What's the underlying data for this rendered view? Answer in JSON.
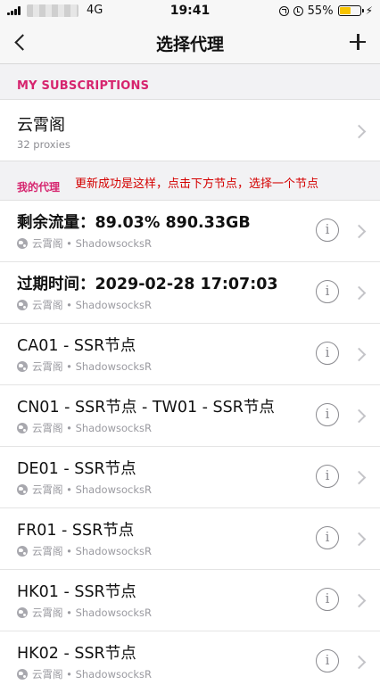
{
  "status_bar": {
    "network": "4G",
    "time": "19:41",
    "battery_percent": "55%",
    "battery_level": 0.55
  },
  "nav": {
    "title": "选择代理",
    "back_icon": "chevron-left-icon",
    "add_icon": "plus-icon"
  },
  "subscriptions": {
    "header": "MY SUBSCRIPTIONS",
    "item": {
      "name": "云霄阁",
      "count": "32 proxies"
    }
  },
  "my_proxies": {
    "header": "我的代理",
    "annotation": "更新成功是这样，点击下方节点，选择一个节点",
    "annotation_color": "#d40000",
    "items": [
      {
        "name": "剩余流量：89.03% 890.33GB",
        "provider": "云霄阁",
        "type": "ShadowsocksR"
      },
      {
        "name": "过期时间：2029-02-28 17:07:03",
        "provider": "云霄阁",
        "type": "ShadowsocksR"
      },
      {
        "name": "CA01 - SSR节点",
        "provider": "云霄阁",
        "type": "ShadowsocksR"
      },
      {
        "name": "CN01 - SSR节点 - TW01 - SSR节点",
        "provider": "云霄阁",
        "type": "ShadowsocksR"
      },
      {
        "name": "DE01 - SSR节点",
        "provider": "云霄阁",
        "type": "ShadowsocksR"
      },
      {
        "name": "FR01 - SSR节点",
        "provider": "云霄阁",
        "type": "ShadowsocksR"
      },
      {
        "name": "HK01 - SSR节点",
        "provider": "云霄阁",
        "type": "ShadowsocksR"
      },
      {
        "name": "HK02 - SSR节点",
        "provider": "云霄阁",
        "type": "ShadowsocksR"
      }
    ]
  },
  "colors": {
    "accent": "#d6246e",
    "battery": "#f7c400"
  }
}
